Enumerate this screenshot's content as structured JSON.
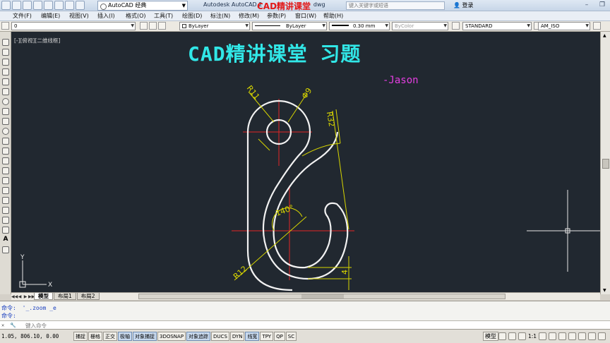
{
  "titlebar": {
    "workspace": "AutoCAD 经典",
    "app_title": "Autodesk AutoCAD 2",
    "file_suffix": "dwg",
    "overlay_title": "CAD精讲课堂",
    "search_placeholder": "键入关键字或短语",
    "login": "登录"
  },
  "menu": [
    {
      "label": "文件(F)"
    },
    {
      "label": "编辑(E)"
    },
    {
      "label": "视图(V)"
    },
    {
      "label": "插入(I)"
    },
    {
      "label": "格式(O)"
    },
    {
      "label": "工具(T)"
    },
    {
      "label": "绘图(D)"
    },
    {
      "label": "标注(N)"
    },
    {
      "label": "修改(M)"
    },
    {
      "label": "参数(P)"
    },
    {
      "label": "窗口(W)"
    },
    {
      "label": "帮助(H)"
    }
  ],
  "properties": {
    "layer": "0",
    "color": "ByLayer",
    "linetype": "ByLayer",
    "lineweight": "0.30 mm",
    "plotstyle": "ByColor",
    "text_style": "STANDARD",
    "dim_style": "AM_ISO"
  },
  "canvas": {
    "viewport_label": "[-][俯视][二维线框]",
    "banner": "CAD精讲课堂 习题",
    "author": "-Jason",
    "dims": {
      "r11": "R11",
      "phi9": "Φ9",
      "r32": "R32",
      "angle": "140°",
      "r12": "R12",
      "h4": "4"
    },
    "ucs": {
      "x": "X",
      "y": "Y"
    }
  },
  "tabs": [
    {
      "label": "模型",
      "active": true
    },
    {
      "label": "布局1",
      "active": false
    },
    {
      "label": "布局2",
      "active": false
    }
  ],
  "command": {
    "history": [
      {
        "prefix": "命令:",
        "text": "'_.zoom _e"
      },
      {
        "prefix": "命令:",
        "text": ""
      }
    ],
    "placeholder": "键入命令"
  },
  "status": {
    "coords": "1.05, 806.10, 0.00",
    "buttons": [
      {
        "label": "捕捉",
        "on": false
      },
      {
        "label": "栅格",
        "on": false
      },
      {
        "label": "正交",
        "on": false
      },
      {
        "label": "极轴",
        "on": true
      },
      {
        "label": "对象捕捉",
        "on": true
      },
      {
        "label": "3DOSNAP",
        "on": false
      },
      {
        "label": "对象追踪",
        "on": true
      },
      {
        "label": "DUCS",
        "on": false
      },
      {
        "label": "DYN",
        "on": false
      },
      {
        "label": "线宽",
        "on": true
      },
      {
        "label": "TPY",
        "on": false
      },
      {
        "label": "QP",
        "on": false
      },
      {
        "label": "SC",
        "on": false
      }
    ],
    "model": "模型",
    "scale": "1:1"
  }
}
